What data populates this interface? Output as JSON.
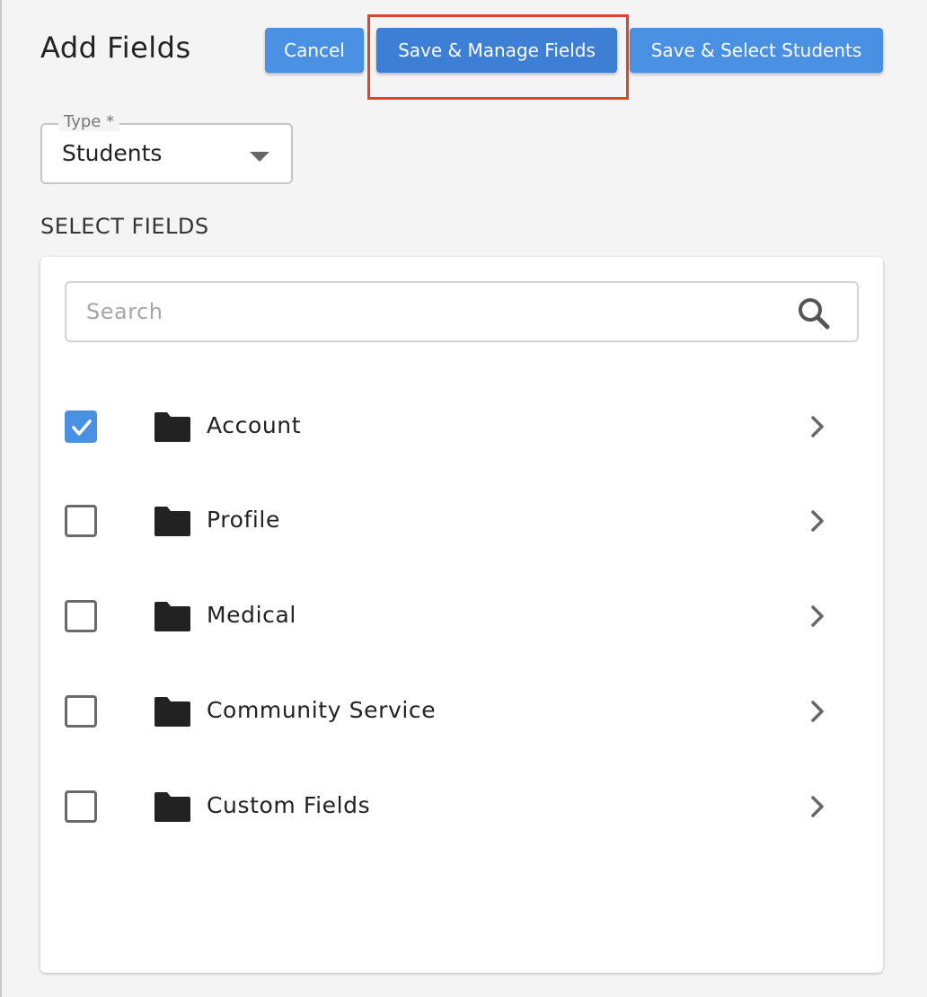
{
  "dialog": {
    "title": "Add Fields",
    "buttons": {
      "cancel": "Cancel",
      "save_manage": "Save & Manage Fields",
      "save_select": "Save & Select Students"
    },
    "type_field": {
      "label": "Type *",
      "value": "Students"
    },
    "section_heading": "SELECT FIELDS",
    "search": {
      "placeholder": "Search",
      "value": ""
    },
    "field_groups": [
      {
        "label": "Account",
        "checked": true
      },
      {
        "label": "Profile",
        "checked": false
      },
      {
        "label": "Medical",
        "checked": false
      },
      {
        "label": "Community Service",
        "checked": false
      },
      {
        "label": "Custom Fields",
        "checked": false
      }
    ]
  },
  "colors": {
    "primary": "#4a90e2",
    "primary_dark": "#3e7fd6",
    "highlight": "#e0432a",
    "background": "#f4f4f4"
  },
  "icons": {
    "search": "search-icon",
    "folder": "folder-icon",
    "chevron": "chevron-right-icon",
    "check": "check-icon",
    "dropdown": "caret-down-icon"
  }
}
